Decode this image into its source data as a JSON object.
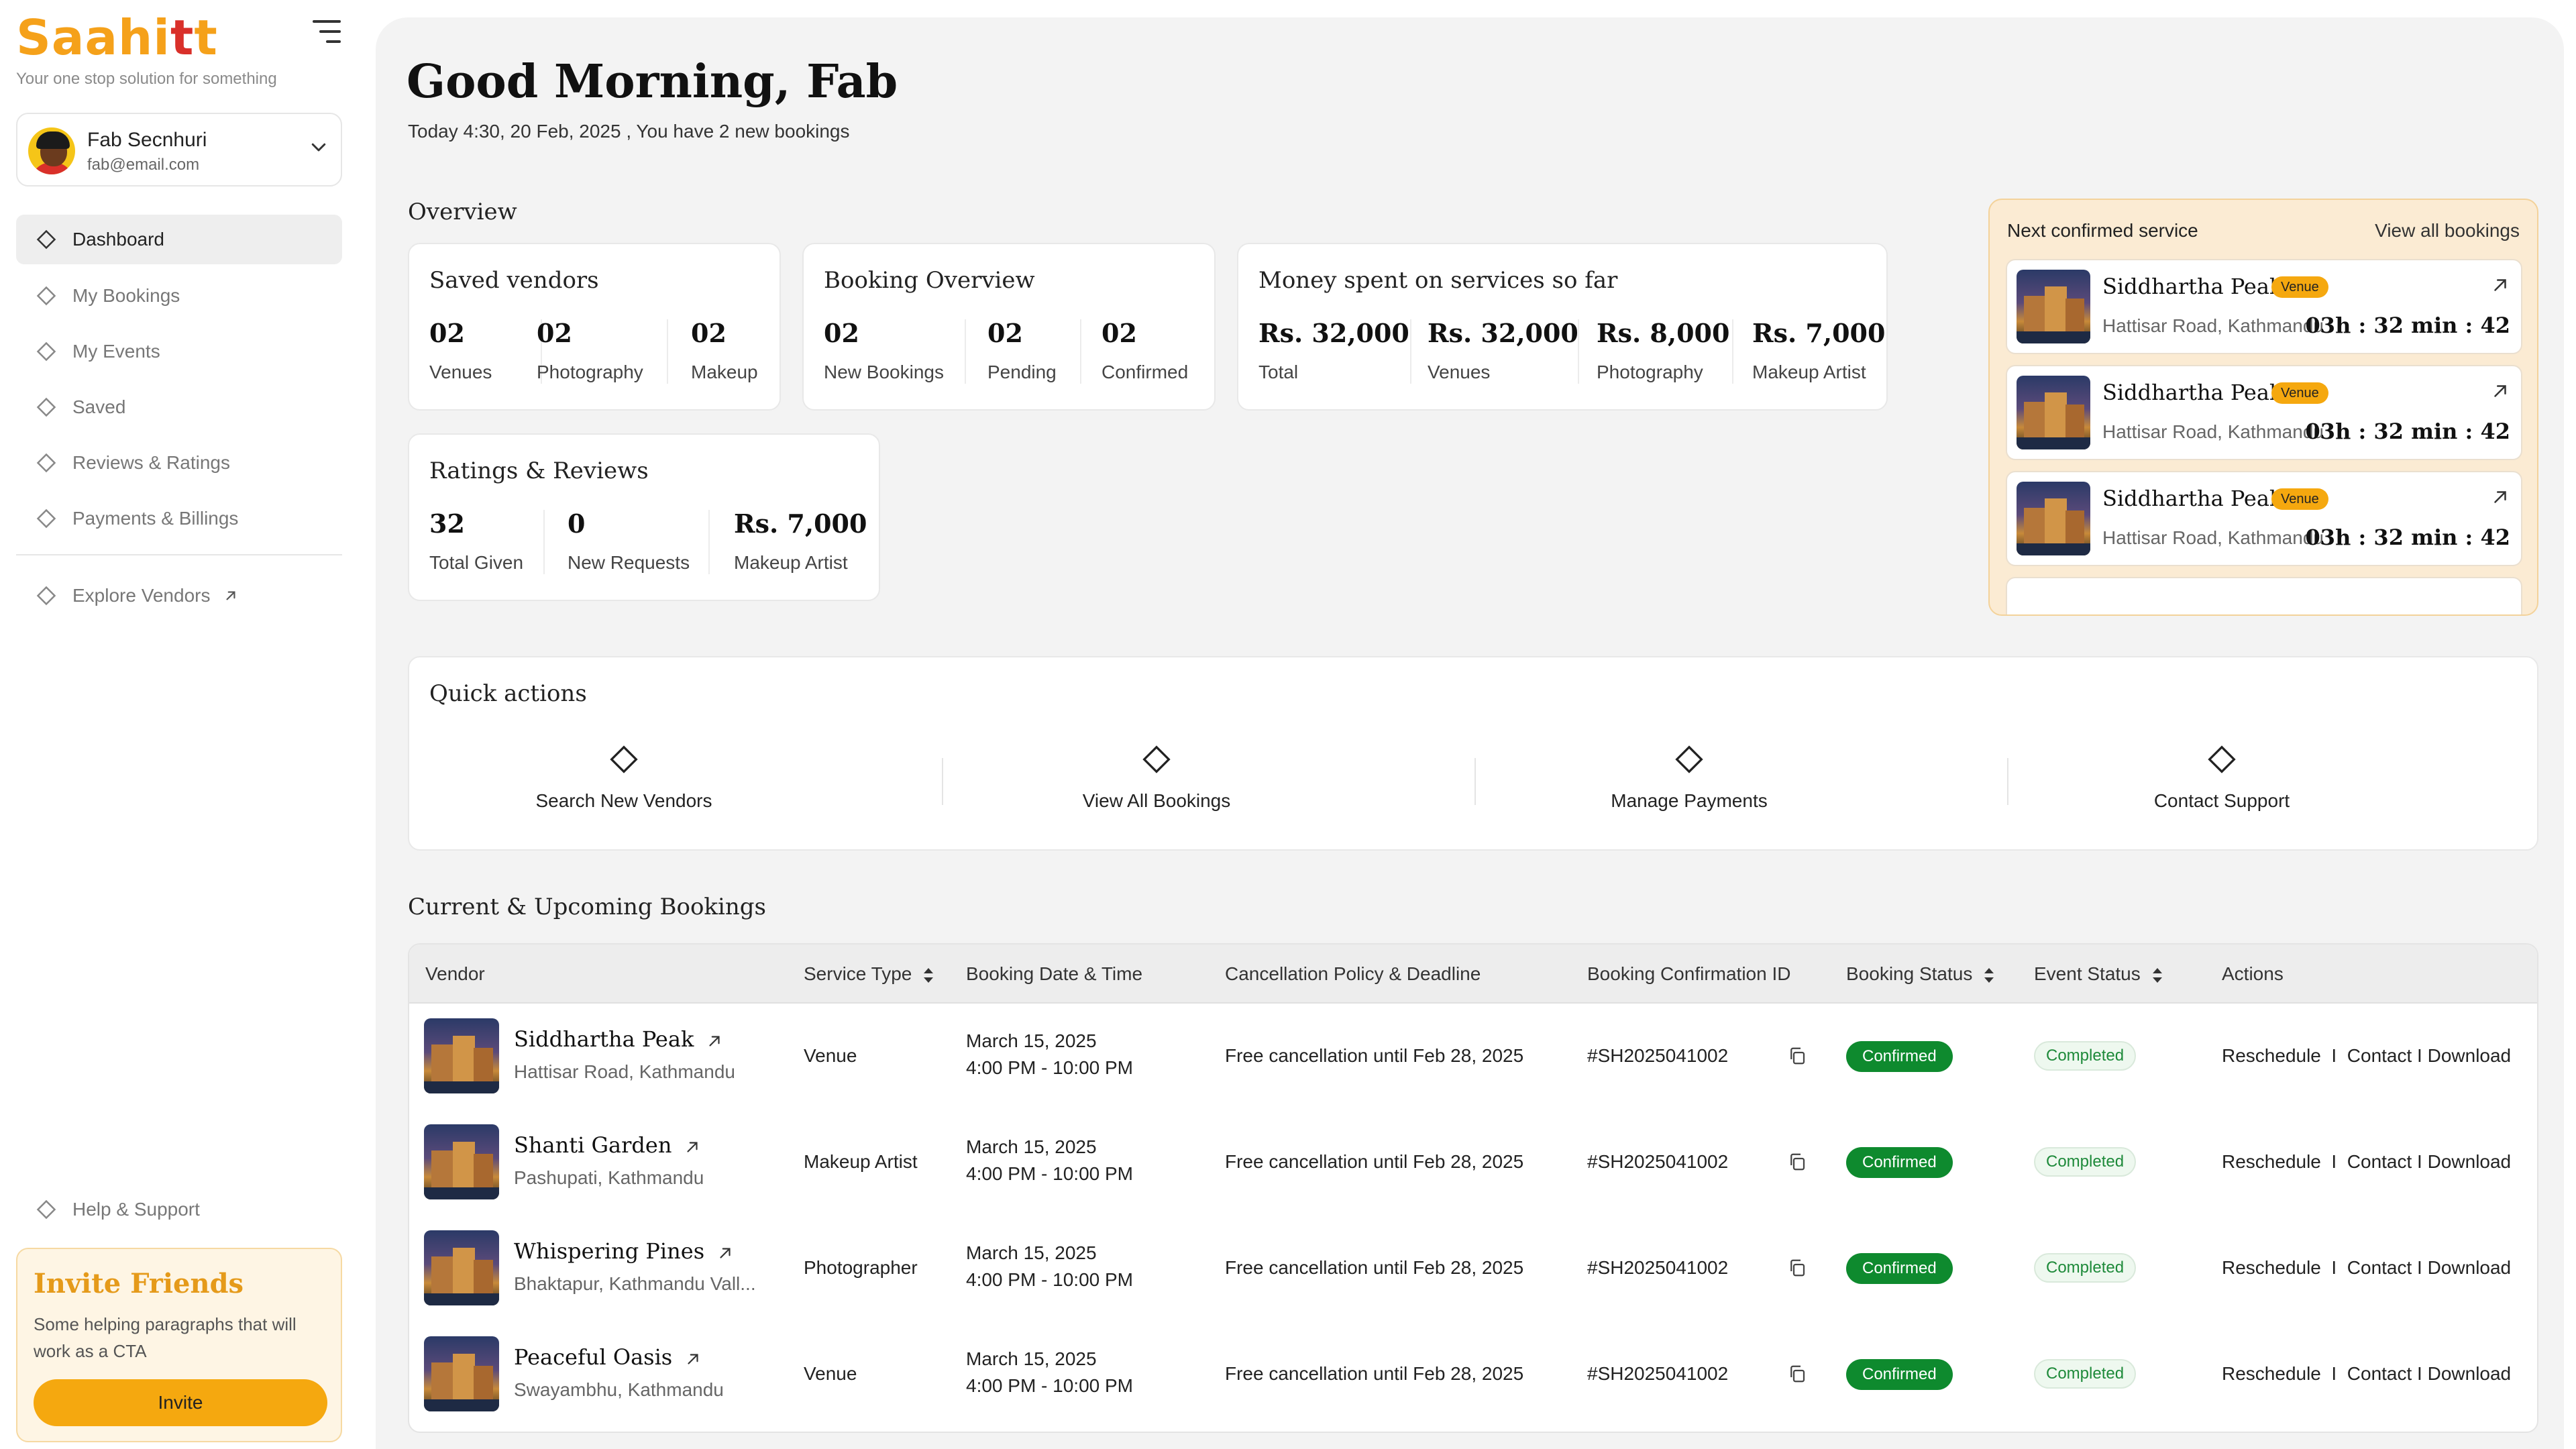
{
  "brand": {
    "logo_prefix": "Saahi",
    "logo_t": "t",
    "logo_suffix": "t",
    "tagline": "Your one stop solution for something",
    "primary_color": "#F5A11A",
    "accent_red": "#D9302A"
  },
  "user": {
    "name": "Fab Secnhuri",
    "email": "fab@email.com"
  },
  "nav": {
    "items": [
      {
        "label": "Dashboard",
        "active": true
      },
      {
        "label": "My Bookings"
      },
      {
        "label": "My Events"
      },
      {
        "label": "Saved"
      },
      {
        "label": "Reviews & Ratings"
      },
      {
        "label": "Payments & Billings"
      }
    ],
    "explore": "Explore Vendors",
    "help": "Help & Support"
  },
  "invite": {
    "title": "Invite Friends",
    "text": "Some helping paragraphs that will work as a CTA",
    "button": "Invite"
  },
  "header": {
    "greeting": "Good Morning, Fab",
    "subline": "Today 4:30, 20 Feb, 2025 ,  You have 2 new bookings"
  },
  "overview": {
    "title": "Overview",
    "saved_vendors": {
      "title": "Saved vendors",
      "stats": [
        {
          "num": "02",
          "label": "Venues"
        },
        {
          "num": "02",
          "label": "Photography"
        },
        {
          "num": "02",
          "label": "Makeup"
        }
      ]
    },
    "booking_overview": {
      "title": "Booking Overview",
      "stats": [
        {
          "num": "02",
          "label": "New Bookings"
        },
        {
          "num": "02",
          "label": "Pending"
        },
        {
          "num": "02",
          "label": "Confirmed"
        }
      ]
    },
    "money_spent": {
      "title": "Money spent on services so far",
      "stats": [
        {
          "num": "Rs. 32,000",
          "label": "Total"
        },
        {
          "num": "Rs. 32,000",
          "label": "Venues"
        },
        {
          "num": "Rs. 8,000",
          "label": "Photography"
        },
        {
          "num": "Rs. 7,000",
          "label": "Makeup Artist"
        }
      ]
    },
    "ratings": {
      "title": "Ratings & Reviews",
      "stats": [
        {
          "num": "32",
          "label": "Total Given"
        },
        {
          "num": "0",
          "label": "New Requests"
        },
        {
          "num": "Rs. 7,000",
          "label": "Makeup Artist"
        }
      ]
    }
  },
  "next_service": {
    "title": "Next confirmed service",
    "link": "View all bookings",
    "items": [
      {
        "name": "Siddhartha Peak",
        "badge": "Venue",
        "address": "Hattisar Road, Kathmandu",
        "countdown": "03h : 32 min : 42"
      },
      {
        "name": "Siddhartha Peak",
        "badge": "Venue",
        "address": "Hattisar Road, Kathmandu",
        "countdown": "03h : 32 min : 42"
      },
      {
        "name": "Siddhartha Peak",
        "badge": "Venue",
        "address": "Hattisar Road, Kathmandu",
        "countdown": "03h : 32 min : 42"
      }
    ]
  },
  "quick_actions": {
    "title": "Quick actions",
    "items": [
      {
        "label": "Search New Vendors"
      },
      {
        "label": "View All Bookings"
      },
      {
        "label": "Manage Payments"
      },
      {
        "label": "Contact Support"
      }
    ]
  },
  "bookings": {
    "title": "Current & Upcoming Bookings",
    "columns": [
      "Vendor",
      "Service Type",
      "Booking Date & Time",
      "Cancellation Policy & Deadline",
      "Booking Confirmation ID",
      "Booking Status",
      "Event Status",
      "Actions"
    ],
    "rows": [
      {
        "vendor": "Siddhartha Peak",
        "address": "Hattisar Road, Kathmandu",
        "service": "Venue",
        "date": "March 15, 2025",
        "time": "4:00 PM - 10:00 PM",
        "policy": "Free cancellation until Feb 28, 2025",
        "id": "#SH2025041002",
        "status": "Confirmed",
        "event": "Completed",
        "actions": "Reschedule  I  Contact I Download"
      },
      {
        "vendor": "Shanti Garden",
        "address": "Pashupati, Kathmandu",
        "service": "Makeup Artist",
        "date": "March 15, 2025",
        "time": "4:00 PM - 10:00 PM",
        "policy": "Free cancellation until Feb 28, 2025",
        "id": "#SH2025041002",
        "status": "Confirmed",
        "event": "Completed",
        "actions": "Reschedule  I  Contact I Download"
      },
      {
        "vendor": "Whispering Pines",
        "address": "Bhaktapur, Kathmandu Vall...",
        "service": "Photographer",
        "date": "March 15, 2025",
        "time": "4:00 PM - 10:00 PM",
        "policy": "Free cancellation until Feb 28, 2025",
        "id": "#SH2025041002",
        "status": "Confirmed",
        "event": "Completed",
        "actions": "Reschedule  I  Contact I Download"
      },
      {
        "vendor": "Peaceful Oasis",
        "address": "Swayambhu, Kathmandu",
        "service": "Venue",
        "date": "March 15, 2025",
        "time": "4:00 PM - 10:00 PM",
        "policy": "Free cancellation until Feb 28, 2025",
        "id": "#SH2025041002",
        "status": "Confirmed",
        "event": "Completed",
        "actions": "Reschedule  I  Contact I Download"
      }
    ]
  }
}
